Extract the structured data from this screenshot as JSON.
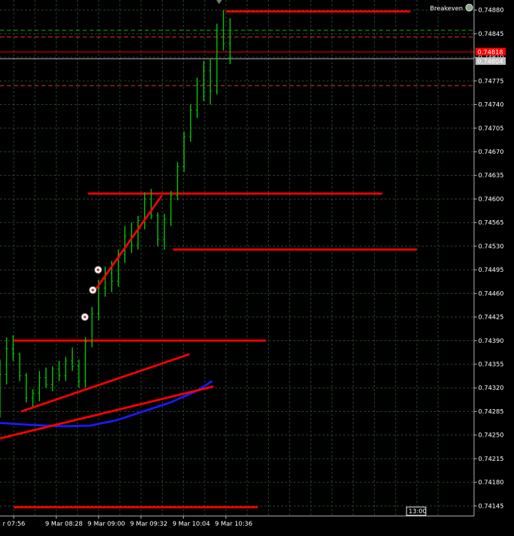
{
  "chart_data": {
    "type": "candlestick",
    "symbol_label": "",
    "indicator_label": "Breakeven",
    "y_ticks": [
      "0.74880",
      "0.74845",
      "0.74810",
      "0.74775",
      "0.74740",
      "0.74705",
      "0.74670",
      "0.74635",
      "0.74600",
      "0.74565",
      "0.74530",
      "0.74495",
      "0.74460",
      "0.74425",
      "0.74390",
      "0.74355",
      "0.74320",
      "0.74285",
      "0.74250",
      "0.74215",
      "0.74180",
      "0.74145"
    ],
    "y_tick_values": [
      0.7488,
      0.74845,
      0.7481,
      0.74775,
      0.7474,
      0.74705,
      0.7467,
      0.74635,
      0.746,
      0.74565,
      0.7453,
      0.74495,
      0.7446,
      0.74425,
      0.7439,
      0.74355,
      0.7432,
      0.74285,
      0.7425,
      0.74215,
      0.7418,
      0.74145
    ],
    "x_ticks": [
      "r 07:56",
      "9 Mar 08:28",
      "9 Mar 09:00",
      "9 Mar 09:32",
      "9 Mar 10:04",
      "9 Mar 10:36"
    ],
    "time_marker": "13:00",
    "price_tags": [
      {
        "label": "0.74818",
        "price": 0.74818,
        "color": "#ff0000"
      },
      {
        "label": "0.74804",
        "price": 0.74804,
        "color": "#c0c0c0"
      }
    ],
    "ylim": [
      0.7413,
      0.74895
    ],
    "grid": true,
    "up_color": "#00c800",
    "background": "#000000",
    "grid_color": "#2a4a2a",
    "support_resistance_levels": [
      {
        "price": 0.74878,
        "color": "#ff0000",
        "time_from": "10:36",
        "time_to": "12:55"
      },
      {
        "price": 0.74608,
        "color": "#ff0000",
        "time_from": "08:52",
        "time_to": "12:34"
      },
      {
        "price": 0.74525,
        "color": "#ff0000",
        "time_from": "09:56",
        "time_to": "13:00"
      },
      {
        "price": 0.7439,
        "color": "#ff0000",
        "time_from": "07:56",
        "time_to": "11:06"
      },
      {
        "price": 0.74143,
        "color": "#ff0000",
        "time_from": "07:56",
        "time_to": "11:00"
      }
    ],
    "dashed_levels": [
      {
        "price": 0.7485,
        "color": "#00c800"
      },
      {
        "price": 0.7484,
        "color": "#ff3333"
      },
      {
        "price": 0.74768,
        "color": "#ff3333"
      }
    ],
    "solid_levels": [
      {
        "price": 0.74818,
        "color": "#ff0000"
      },
      {
        "price": 0.74808,
        "color": "#c0c0c0"
      }
    ],
    "trendlines": [
      {
        "from": [
          "09:06",
          0.7446
        ],
        "to": [
          "09:58",
          0.74605
        ],
        "color": "#ff0000"
      },
      {
        "from": [
          "08:12",
          0.74285
        ],
        "to": [
          "10:19",
          0.7437
        ],
        "color": "#ff0000"
      },
      {
        "from": [
          "07:56",
          0.74245
        ],
        "to": [
          "10:37",
          0.74322
        ],
        "color": "#ff0000"
      }
    ],
    "moving_average": {
      "color": "#1a1aff",
      "points": [
        [
          "07:56",
          0.74268
        ],
        [
          "08:20",
          0.74265
        ],
        [
          "08:44",
          0.74263
        ],
        [
          "09:04",
          0.74264
        ],
        [
          "09:24",
          0.74272
        ],
        [
          "09:44",
          0.74285
        ],
        [
          "10:04",
          0.74298
        ],
        [
          "10:24",
          0.74315
        ],
        [
          "10:36",
          0.7433
        ]
      ]
    },
    "series": [
      {
        "values": [
          [
            0.74276,
            0.74362,
            0.74276,
            0.7434
          ],
          [
            0.7434,
            0.74395,
            0.74325,
            0.74378
          ],
          [
            0.74378,
            0.74398,
            0.7436,
            0.7437
          ],
          [
            0.7437,
            0.74372,
            0.7433,
            0.74338
          ],
          [
            0.74338,
            0.74342,
            0.74298,
            0.74305
          ],
          [
            0.74305,
            0.74318,
            0.7429,
            0.74312
          ],
          [
            0.74312,
            0.74345,
            0.743,
            0.74335
          ],
          [
            0.74335,
            0.7435,
            0.7432,
            0.74325
          ],
          [
            0.74325,
            0.74352,
            0.74315,
            0.74348
          ],
          [
            0.74348,
            0.7436,
            0.7433,
            0.74338
          ],
          [
            0.74338,
            0.74366,
            0.7433,
            0.7436
          ],
          [
            0.7436,
            0.7438,
            0.74345,
            0.74352
          ],
          [
            0.74352,
            0.74362,
            0.7432,
            0.7433
          ],
          [
            0.7433,
            0.74395,
            0.7432,
            0.74388
          ],
          [
            0.74388,
            0.7444,
            0.7438,
            0.7443
          ],
          [
            0.7443,
            0.7448,
            0.7442,
            0.74468
          ],
          [
            0.74468,
            0.745,
            0.74455,
            0.7449
          ],
          [
            0.7449,
            0.74508,
            0.74462,
            0.74478
          ],
          [
            0.74478,
            0.74525,
            0.7447,
            0.74518
          ],
          [
            0.74518,
            0.7456,
            0.74505,
            0.74545
          ],
          [
            0.74545,
            0.74565,
            0.7452,
            0.74532
          ],
          [
            0.74532,
            0.74575,
            0.74525,
            0.74568
          ],
          [
            0.74568,
            0.7461,
            0.74555,
            0.746
          ],
          [
            0.746,
            0.74615,
            0.7457,
            0.74575
          ],
          [
            0.74575,
            0.7458,
            0.7453,
            0.7454
          ],
          [
            0.7454,
            0.74578,
            0.74525,
            0.7457
          ],
          [
            0.7457,
            0.74612,
            0.7456,
            0.74605
          ],
          [
            0.74605,
            0.74655,
            0.74598,
            0.74648
          ],
          [
            0.74648,
            0.747,
            0.7464,
            0.74692
          ],
          [
            0.74692,
            0.7474,
            0.74685,
            0.74732
          ],
          [
            0.74732,
            0.7478,
            0.7472,
            0.7477
          ],
          [
            0.7477,
            0.74805,
            0.74745,
            0.7479
          ],
          [
            0.7479,
            0.74808,
            0.7474,
            0.7476
          ],
          [
            0.7476,
            0.7486,
            0.74755,
            0.7485
          ],
          [
            0.7485,
            0.7488,
            0.7482,
            0.7483
          ],
          [
            0.7483,
            0.74868,
            0.748,
            0.7481
          ]
        ]
      }
    ]
  }
}
